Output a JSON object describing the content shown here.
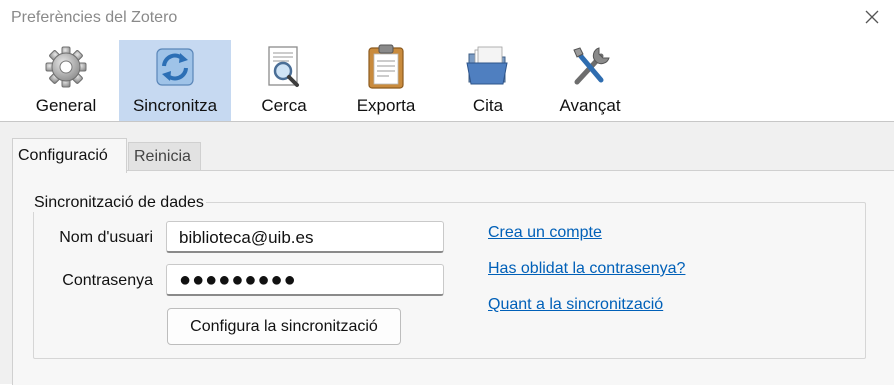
{
  "window": {
    "title": "Preferències del Zotero"
  },
  "toolbar": {
    "items": [
      {
        "label": "General",
        "icon": "gear-icon"
      },
      {
        "label": "Sincronitza",
        "icon": "sync-icon"
      },
      {
        "label": "Cerca",
        "icon": "search-document-icon"
      },
      {
        "label": "Exporta",
        "icon": "clipboard-icon"
      },
      {
        "label": "Cita",
        "icon": "folder-icon"
      },
      {
        "label": "Avançat",
        "icon": "tools-icon"
      }
    ],
    "selected": "Sincronitza"
  },
  "tabs": {
    "items": [
      {
        "label": "Configuració",
        "active": true
      },
      {
        "label": "Reinicia",
        "active": false
      }
    ]
  },
  "sync": {
    "group_title": "Sincronització de dades",
    "username_label": "Nom d'usuari",
    "username_value": "biblioteca@uib.es",
    "password_label": "Contrasenya",
    "password_value": "●●●●●●●●●",
    "config_button": "Configura la sincronització",
    "links": [
      {
        "label": "Crea un compte"
      },
      {
        "label": "Has oblidat la contrasenya?"
      },
      {
        "label": "Quant a la sincronització"
      }
    ]
  },
  "colors": {
    "selected_tool_bg": "#c6d9f1",
    "link": "#0060b8",
    "panel_bg": "#f0f0f0"
  }
}
